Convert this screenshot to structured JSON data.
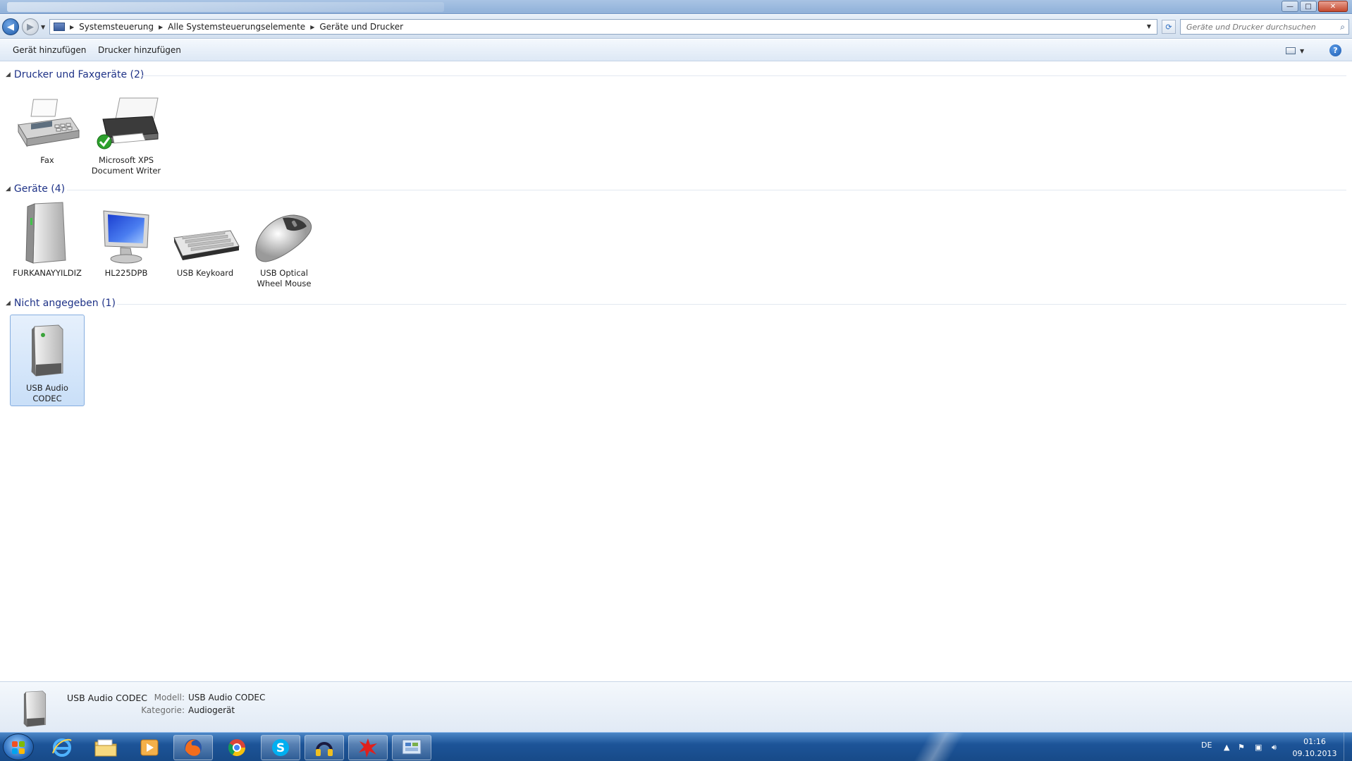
{
  "window": {
    "controls": {
      "minimize": "—",
      "maximize": "□",
      "close": "✕"
    }
  },
  "address": {
    "breadcrumbs": [
      "Systemsteuerung",
      "Alle Systemsteuerungselemente",
      "Geräte und Drucker"
    ],
    "search_placeholder": "Geräte und Drucker durchsuchen"
  },
  "commands": {
    "add_device": "Gerät hinzufügen",
    "add_printer": "Drucker hinzufügen"
  },
  "groups": {
    "printers": {
      "title": "Drucker und Faxgeräte (2)",
      "items": [
        {
          "label": "Fax",
          "icon": "fax-icon"
        },
        {
          "label": "Microsoft XPS Document Writer",
          "icon": "printer-default-icon"
        }
      ]
    },
    "devices": {
      "title": "Geräte (4)",
      "items": [
        {
          "label": "FURKANAYYILDIZ",
          "icon": "computer-tower-icon"
        },
        {
          "label": "HL225DPB",
          "icon": "monitor-icon"
        },
        {
          "label": "USB Keykoard",
          "icon": "keyboard-icon"
        },
        {
          "label": "USB Optical Wheel Mouse",
          "icon": "mouse-icon"
        }
      ]
    },
    "unspecified": {
      "title": "Nicht angegeben (1)",
      "items": [
        {
          "label": "USB Audio CODEC",
          "icon": "audio-device-icon",
          "selected": true
        }
      ]
    }
  },
  "details": {
    "name": "USB Audio CODEC",
    "model_label": "Modell:",
    "model_value": "USB Audio CODEC",
    "category_label": "Kategorie:",
    "category_value": "Audiogerät"
  },
  "taskbar": {
    "apps": [
      "internet-explorer-icon",
      "explorer-folder-icon",
      "media-player-icon",
      "firefox-icon",
      "chrome-icon",
      "skype-icon",
      "headphones-app-icon",
      "red-splash-app-icon",
      "control-panel-icon"
    ],
    "language": "DE",
    "time": "01:16",
    "date": "09.10.2013"
  },
  "colors": {
    "group_title": "#1e3287",
    "selection": "#c9dff8",
    "taskbar": "#1d5498"
  }
}
